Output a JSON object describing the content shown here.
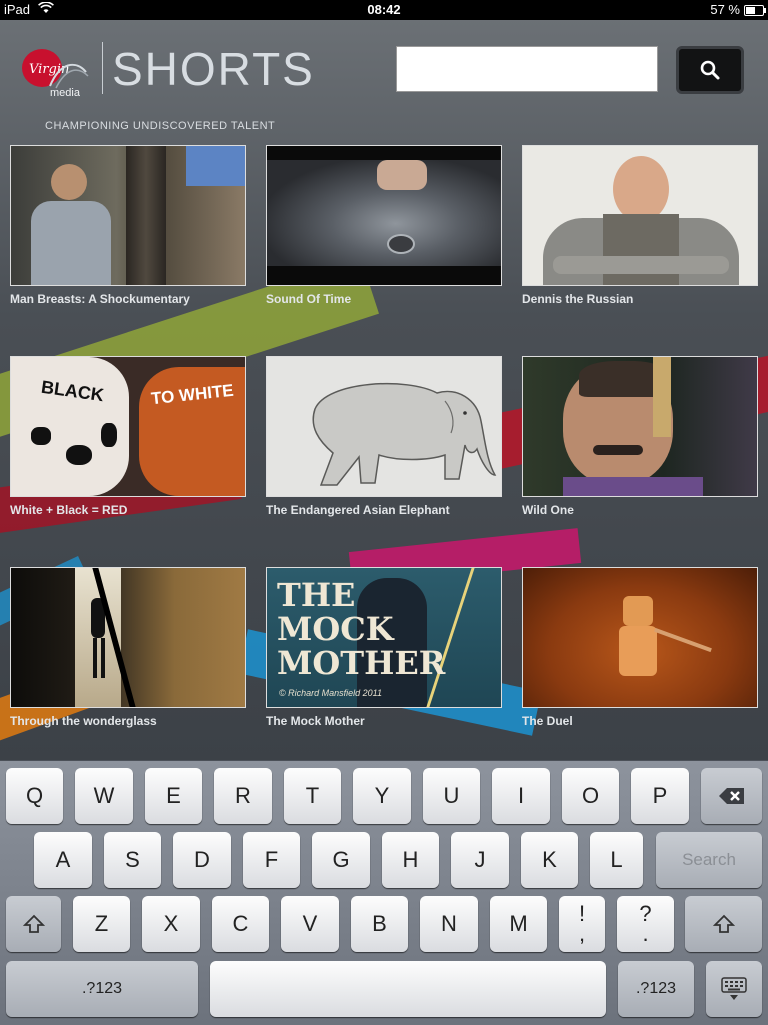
{
  "status_bar": {
    "device": "iPad",
    "time": "08:42",
    "battery": "57 %",
    "battery_level": 0.57
  },
  "header": {
    "brand_mark": "Virgin media",
    "title": "SHORTS",
    "tagline": "CHAMPIONING UNDISCOVERED TALENT"
  },
  "search": {
    "value": "",
    "placeholder": ""
  },
  "films": [
    {
      "title": "Man Breasts: A Shockumentary"
    },
    {
      "title": "Sound Of Time"
    },
    {
      "title": "Dennis the Russian"
    },
    {
      "title": "White  + Black = RED"
    },
    {
      "title": "The Endangered Asian Elephant"
    },
    {
      "title": "Wild One"
    },
    {
      "title": "Through the wonderglass"
    },
    {
      "title": "The Mock Mother"
    },
    {
      "title": "The Duel"
    }
  ],
  "poster": {
    "line1": "THE",
    "line2": "MOCK",
    "line3": "MOTHER",
    "credit": "© Richard Mansfield 2011"
  },
  "belly_text": {
    "left": "BLACK",
    "right": "TO WHITE"
  },
  "keyboard": {
    "row1": [
      "Q",
      "W",
      "E",
      "R",
      "T",
      "Y",
      "U",
      "I",
      "O",
      "P"
    ],
    "row2": [
      "A",
      "S",
      "D",
      "F",
      "G",
      "H",
      "J",
      "K",
      "L"
    ],
    "row3": [
      "Z",
      "X",
      "C",
      "V",
      "B",
      "N",
      "M"
    ],
    "punct1": {
      "top": "!",
      "bottom": ","
    },
    "punct2": {
      "top": "?",
      "bottom": "."
    },
    "search_key": "Search",
    "numbers_key": ".?123",
    "space_key": ""
  },
  "colors": {
    "status_bar": "#000000",
    "search_button": "#121314",
    "swoosh_red": "#b0182a",
    "swoosh_green": "#8fa53a",
    "swoosh_blue": "#1e8ec9",
    "swoosh_pink": "#c21a6a",
    "swoosh_orange": "#e07a10"
  }
}
